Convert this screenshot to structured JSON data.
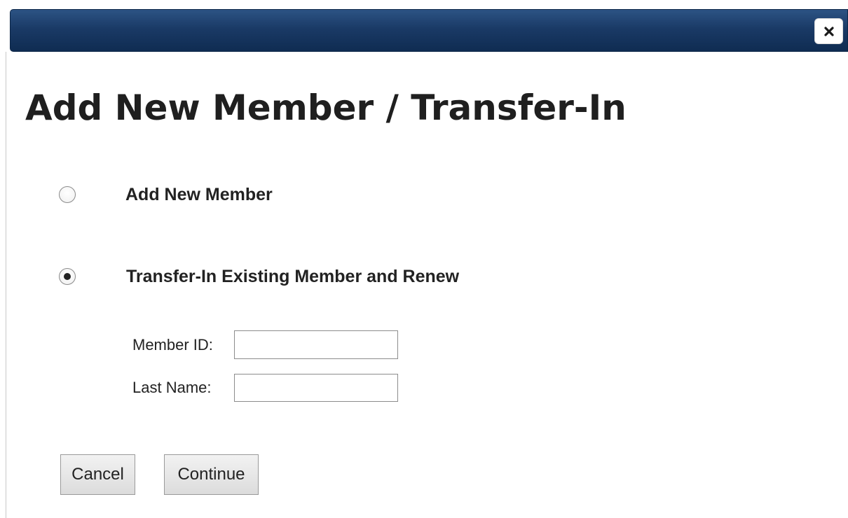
{
  "dialog": {
    "title": "Add New Member / Transfer-In",
    "close_icon": "close-icon"
  },
  "options": {
    "add_new": {
      "label": "Add New Member",
      "selected": false
    },
    "transfer_in": {
      "label": "Transfer-In Existing Member and Renew",
      "selected": true
    }
  },
  "form": {
    "member_id": {
      "label": "Member ID:",
      "value": ""
    },
    "last_name": {
      "label": "Last Name:",
      "value": ""
    }
  },
  "buttons": {
    "cancel": "Cancel",
    "continue": "Continue"
  }
}
